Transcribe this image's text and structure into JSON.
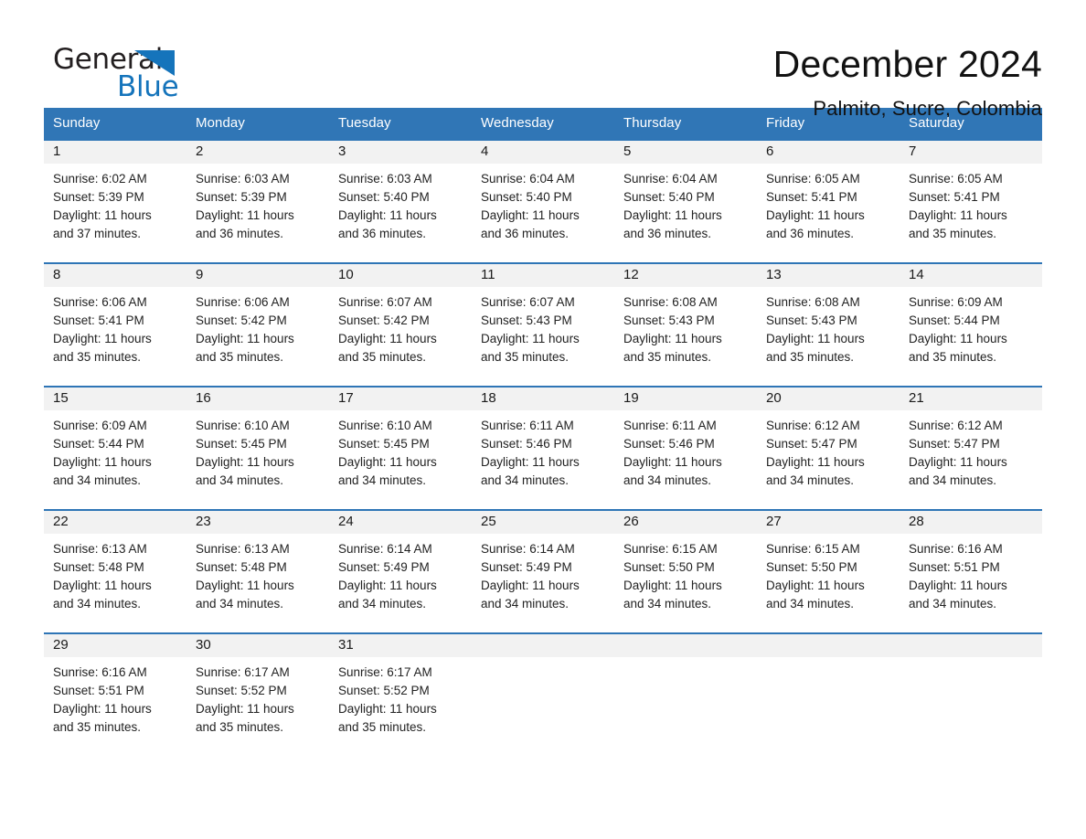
{
  "logo": {
    "word_general": "General",
    "word_blue": "Blue",
    "triangle_color": "#1574bb"
  },
  "header": {
    "month_title": "December 2024",
    "location": "Palmito, Sucre, Colombia",
    "header_bg_color": "#3076b6",
    "row_border_color": "#2e75b6",
    "day_band_color": "#f2f2f2"
  },
  "weekdays": [
    {
      "label": "Sunday"
    },
    {
      "label": "Monday"
    },
    {
      "label": "Tuesday"
    },
    {
      "label": "Wednesday"
    },
    {
      "label": "Thursday"
    },
    {
      "label": "Friday"
    },
    {
      "label": "Saturday"
    }
  ],
  "weeks": [
    {
      "days": [
        {
          "number": "1",
          "sunrise": "Sunrise: 6:02 AM",
          "sunset": "Sunset: 5:39 PM",
          "daylight_line1": "Daylight: 11 hours",
          "daylight_line2": "and 37 minutes."
        },
        {
          "number": "2",
          "sunrise": "Sunrise: 6:03 AM",
          "sunset": "Sunset: 5:39 PM",
          "daylight_line1": "Daylight: 11 hours",
          "daylight_line2": "and 36 minutes."
        },
        {
          "number": "3",
          "sunrise": "Sunrise: 6:03 AM",
          "sunset": "Sunset: 5:40 PM",
          "daylight_line1": "Daylight: 11 hours",
          "daylight_line2": "and 36 minutes."
        },
        {
          "number": "4",
          "sunrise": "Sunrise: 6:04 AM",
          "sunset": "Sunset: 5:40 PM",
          "daylight_line1": "Daylight: 11 hours",
          "daylight_line2": "and 36 minutes."
        },
        {
          "number": "5",
          "sunrise": "Sunrise: 6:04 AM",
          "sunset": "Sunset: 5:40 PM",
          "daylight_line1": "Daylight: 11 hours",
          "daylight_line2": "and 36 minutes."
        },
        {
          "number": "6",
          "sunrise": "Sunrise: 6:05 AM",
          "sunset": "Sunset: 5:41 PM",
          "daylight_line1": "Daylight: 11 hours",
          "daylight_line2": "and 36 minutes."
        },
        {
          "number": "7",
          "sunrise": "Sunrise: 6:05 AM",
          "sunset": "Sunset: 5:41 PM",
          "daylight_line1": "Daylight: 11 hours",
          "daylight_line2": "and 35 minutes."
        }
      ]
    },
    {
      "days": [
        {
          "number": "8",
          "sunrise": "Sunrise: 6:06 AM",
          "sunset": "Sunset: 5:41 PM",
          "daylight_line1": "Daylight: 11 hours",
          "daylight_line2": "and 35 minutes."
        },
        {
          "number": "9",
          "sunrise": "Sunrise: 6:06 AM",
          "sunset": "Sunset: 5:42 PM",
          "daylight_line1": "Daylight: 11 hours",
          "daylight_line2": "and 35 minutes."
        },
        {
          "number": "10",
          "sunrise": "Sunrise: 6:07 AM",
          "sunset": "Sunset: 5:42 PM",
          "daylight_line1": "Daylight: 11 hours",
          "daylight_line2": "and 35 minutes."
        },
        {
          "number": "11",
          "sunrise": "Sunrise: 6:07 AM",
          "sunset": "Sunset: 5:43 PM",
          "daylight_line1": "Daylight: 11 hours",
          "daylight_line2": "and 35 minutes."
        },
        {
          "number": "12",
          "sunrise": "Sunrise: 6:08 AM",
          "sunset": "Sunset: 5:43 PM",
          "daylight_line1": "Daylight: 11 hours",
          "daylight_line2": "and 35 minutes."
        },
        {
          "number": "13",
          "sunrise": "Sunrise: 6:08 AM",
          "sunset": "Sunset: 5:43 PM",
          "daylight_line1": "Daylight: 11 hours",
          "daylight_line2": "and 35 minutes."
        },
        {
          "number": "14",
          "sunrise": "Sunrise: 6:09 AM",
          "sunset": "Sunset: 5:44 PM",
          "daylight_line1": "Daylight: 11 hours",
          "daylight_line2": "and 35 minutes."
        }
      ]
    },
    {
      "days": [
        {
          "number": "15",
          "sunrise": "Sunrise: 6:09 AM",
          "sunset": "Sunset: 5:44 PM",
          "daylight_line1": "Daylight: 11 hours",
          "daylight_line2": "and 34 minutes."
        },
        {
          "number": "16",
          "sunrise": "Sunrise: 6:10 AM",
          "sunset": "Sunset: 5:45 PM",
          "daylight_line1": "Daylight: 11 hours",
          "daylight_line2": "and 34 minutes."
        },
        {
          "number": "17",
          "sunrise": "Sunrise: 6:10 AM",
          "sunset": "Sunset: 5:45 PM",
          "daylight_line1": "Daylight: 11 hours",
          "daylight_line2": "and 34 minutes."
        },
        {
          "number": "18",
          "sunrise": "Sunrise: 6:11 AM",
          "sunset": "Sunset: 5:46 PM",
          "daylight_line1": "Daylight: 11 hours",
          "daylight_line2": "and 34 minutes."
        },
        {
          "number": "19",
          "sunrise": "Sunrise: 6:11 AM",
          "sunset": "Sunset: 5:46 PM",
          "daylight_line1": "Daylight: 11 hours",
          "daylight_line2": "and 34 minutes."
        },
        {
          "number": "20",
          "sunrise": "Sunrise: 6:12 AM",
          "sunset": "Sunset: 5:47 PM",
          "daylight_line1": "Daylight: 11 hours",
          "daylight_line2": "and 34 minutes."
        },
        {
          "number": "21",
          "sunrise": "Sunrise: 6:12 AM",
          "sunset": "Sunset: 5:47 PM",
          "daylight_line1": "Daylight: 11 hours",
          "daylight_line2": "and 34 minutes."
        }
      ]
    },
    {
      "days": [
        {
          "number": "22",
          "sunrise": "Sunrise: 6:13 AM",
          "sunset": "Sunset: 5:48 PM",
          "daylight_line1": "Daylight: 11 hours",
          "daylight_line2": "and 34 minutes."
        },
        {
          "number": "23",
          "sunrise": "Sunrise: 6:13 AM",
          "sunset": "Sunset: 5:48 PM",
          "daylight_line1": "Daylight: 11 hours",
          "daylight_line2": "and 34 minutes."
        },
        {
          "number": "24",
          "sunrise": "Sunrise: 6:14 AM",
          "sunset": "Sunset: 5:49 PM",
          "daylight_line1": "Daylight: 11 hours",
          "daylight_line2": "and 34 minutes."
        },
        {
          "number": "25",
          "sunrise": "Sunrise: 6:14 AM",
          "sunset": "Sunset: 5:49 PM",
          "daylight_line1": "Daylight: 11 hours",
          "daylight_line2": "and 34 minutes."
        },
        {
          "number": "26",
          "sunrise": "Sunrise: 6:15 AM",
          "sunset": "Sunset: 5:50 PM",
          "daylight_line1": "Daylight: 11 hours",
          "daylight_line2": "and 34 minutes."
        },
        {
          "number": "27",
          "sunrise": "Sunrise: 6:15 AM",
          "sunset": "Sunset: 5:50 PM",
          "daylight_line1": "Daylight: 11 hours",
          "daylight_line2": "and 34 minutes."
        },
        {
          "number": "28",
          "sunrise": "Sunrise: 6:16 AM",
          "sunset": "Sunset: 5:51 PM",
          "daylight_line1": "Daylight: 11 hours",
          "daylight_line2": "and 34 minutes."
        }
      ]
    },
    {
      "days": [
        {
          "number": "29",
          "sunrise": "Sunrise: 6:16 AM",
          "sunset": "Sunset: 5:51 PM",
          "daylight_line1": "Daylight: 11 hours",
          "daylight_line2": "and 35 minutes."
        },
        {
          "number": "30",
          "sunrise": "Sunrise: 6:17 AM",
          "sunset": "Sunset: 5:52 PM",
          "daylight_line1": "Daylight: 11 hours",
          "daylight_line2": "and 35 minutes."
        },
        {
          "number": "31",
          "sunrise": "Sunrise: 6:17 AM",
          "sunset": "Sunset: 5:52 PM",
          "daylight_line1": "Daylight: 11 hours",
          "daylight_line2": "and 35 minutes."
        },
        {
          "number": "",
          "sunrise": "",
          "sunset": "",
          "daylight_line1": "",
          "daylight_line2": ""
        },
        {
          "number": "",
          "sunrise": "",
          "sunset": "",
          "daylight_line1": "",
          "daylight_line2": ""
        },
        {
          "number": "",
          "sunrise": "",
          "sunset": "",
          "daylight_line1": "",
          "daylight_line2": ""
        },
        {
          "number": "",
          "sunrise": "",
          "sunset": "",
          "daylight_line1": "",
          "daylight_line2": ""
        }
      ]
    }
  ]
}
